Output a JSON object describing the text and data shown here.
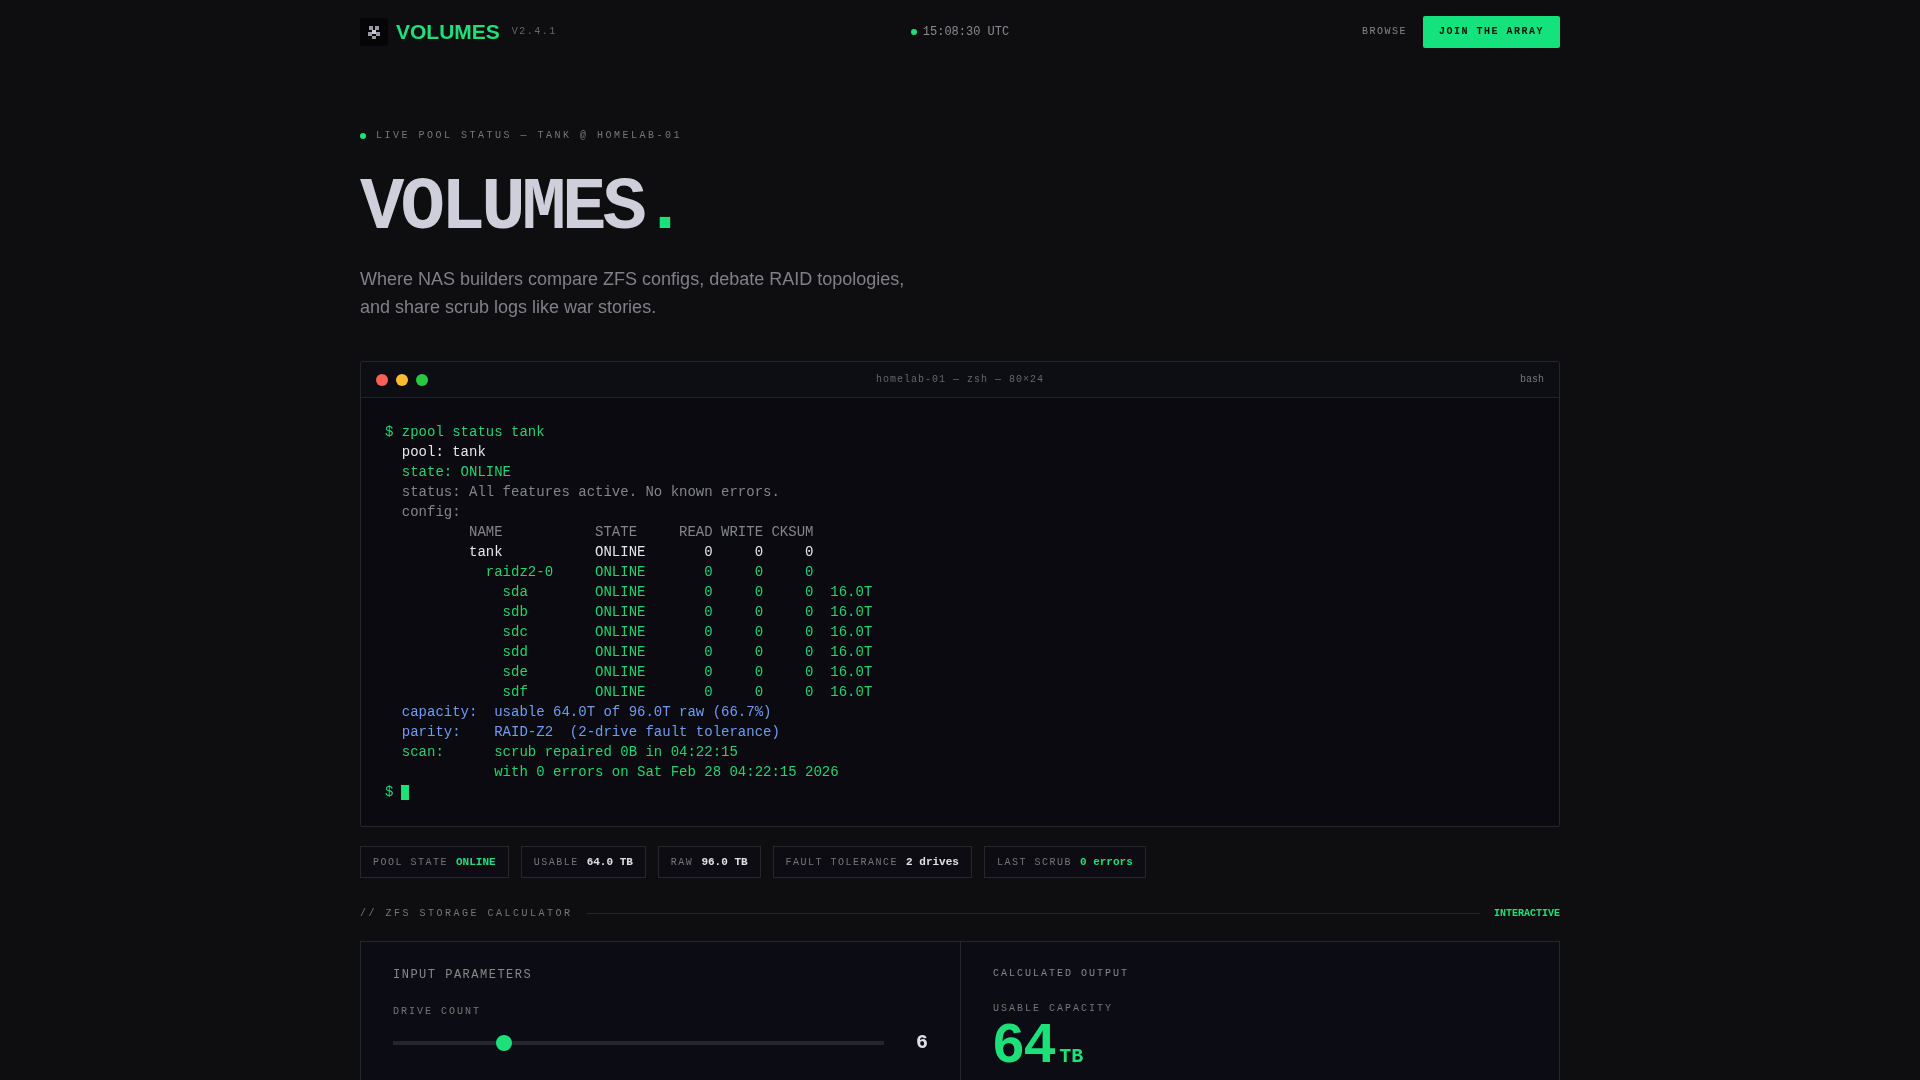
{
  "header": {
    "brand": "VOLUMES",
    "version": "V2.4.1",
    "clock": "15:08:30 UTC",
    "nav": [
      {
        "label": "BROWSE",
        "kind": "link"
      },
      {
        "label": "JOIN THE ARRAY",
        "kind": "primary"
      }
    ]
  },
  "hero": {
    "eyebrow": "LIVE POOL STATUS — TANK @ HOMELAB-01",
    "title": "VOLUMES",
    "title_mark": ".",
    "subtitle": "Where NAS builders compare ZFS configs, debate RAID topologies, and share scrub logs like war stories."
  },
  "terminal": {
    "title": "homelab-01 — zsh — 80×24",
    "shell": "bash",
    "lines": [
      {
        "text": "$ zpool status tank",
        "kind": "green"
      },
      {
        "text": "  pool: tank",
        "kind": "white"
      },
      {
        "text": "  state: ONLINE",
        "kind": "green"
      },
      {
        "text": "  status: All features active. No known errors.",
        "kind": "gray"
      },
      {
        "text": "  config:",
        "kind": "gray"
      },
      {
        "text": "          NAME           STATE     READ WRITE CKSUM",
        "kind": "gray"
      },
      {
        "text": "          tank           ONLINE       0     0     0",
        "kind": "white"
      },
      {
        "text": "            raidz2-0     ONLINE       0     0     0",
        "kind": "green"
      },
      {
        "text": "              sda        ONLINE       0     0     0  16.0T",
        "kind": "green"
      },
      {
        "text": "              sdb        ONLINE       0     0     0  16.0T",
        "kind": "green"
      },
      {
        "text": "              sdc        ONLINE       0     0     0  16.0T",
        "kind": "green"
      },
      {
        "text": "              sdd        ONLINE       0     0     0  16.0T",
        "kind": "green"
      },
      {
        "text": "              sde        ONLINE       0     0     0  16.0T",
        "kind": "green"
      },
      {
        "text": "              sdf        ONLINE       0     0     0  16.0T",
        "kind": "green"
      },
      {
        "text": "  capacity:  usable 64.0T of 96.0T raw (66.7%)",
        "kind": "blue"
      },
      {
        "text": "  parity:    RAID-Z2  (2-drive fault tolerance)",
        "kind": "blue"
      },
      {
        "text": "  scan:      scrub repaired 0B in 04:22:15",
        "kind": "green"
      },
      {
        "text": "             with 0 errors on Sat Feb 28 04:22:15 2026",
        "kind": "green"
      }
    ],
    "prompt": "$"
  },
  "stats": [
    {
      "label": "POOL STATE",
      "value": "ONLINE",
      "kind": "good"
    },
    {
      "label": "USABLE",
      "value": "64.0 TB",
      "kind": "plain"
    },
    {
      "label": "RAW",
      "value": "96.0 TB",
      "kind": "plain"
    },
    {
      "label": "FAULT TOLERANCE",
      "value": "2 drives",
      "kind": "plain"
    },
    {
      "label": "LAST SCRUB",
      "value": "0 errors",
      "kind": "good"
    }
  ],
  "section": {
    "title": "// ZFS STORAGE CALCULATOR",
    "badge": "INTERACTIVE"
  },
  "calculator": {
    "input": {
      "title": "INPUT PARAMETERS",
      "drive_count": {
        "label": "DRIVE COUNT",
        "level": 0.226,
        "value": "6"
      }
    },
    "output": {
      "title": "CALCULATED OUTPUT",
      "usable": {
        "label": "USABLE CAPACITY",
        "value": "64",
        "unit": "TB"
      }
    }
  }
}
